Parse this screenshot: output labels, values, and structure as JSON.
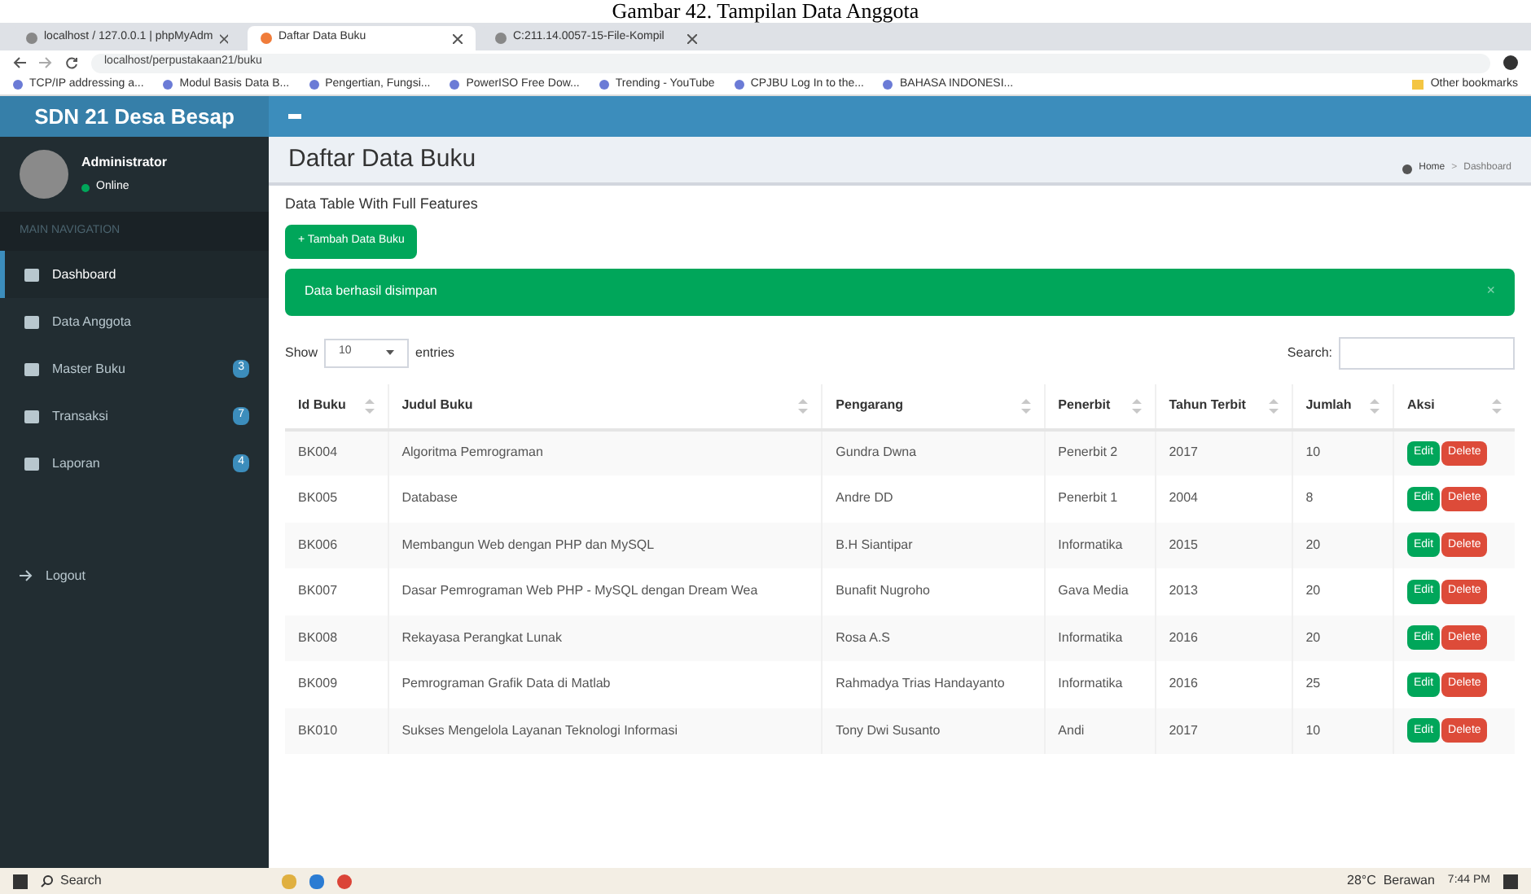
{
  "caption": "Gambar 42. Tampilan Data Anggota",
  "browser": {
    "tabs": [
      {
        "title": "localhost / 127.0.0.1 | phpMyAdm",
        "selected": false
      },
      {
        "title": "Daftar Data Buku",
        "selected": true
      },
      {
        "title": "C:211.14.0057-15-File-Kompil",
        "selected": false
      }
    ],
    "address": "localhost/perpustakaan21/buku",
    "bookmarks": [
      "TCP/IP addressing a...",
      "Modul Basis Data B...",
      "Pengertian, Fungsi...",
      "PowerISO Free Dow...",
      "Trending - YouTube",
      "CPJBU Log In to the...",
      "BAHASA INDONESI..."
    ],
    "other_bookmarks": "Other bookmarks"
  },
  "app": {
    "brand": "SDN 21 Desa Besap",
    "user": {
      "name": "Administrator",
      "status": "Online"
    },
    "nav_header": "MAIN NAVIGATION",
    "nav": [
      {
        "label": "Dashboard",
        "selected": true
      },
      {
        "label": "Data Anggota",
        "selected": false
      },
      {
        "label": "Master Buku",
        "selected": false,
        "badge": "3"
      },
      {
        "label": "Transaksi",
        "selected": false,
        "badge": "7"
      },
      {
        "label": "Laporan",
        "selected": false,
        "badge": "4"
      }
    ],
    "logout": "Logout",
    "page_title": "Daftar Data Buku",
    "breadcrumb": [
      "Home",
      "Dashboard"
    ],
    "breadcrumb_separator": ">",
    "subtitle": "Data Table With Full Features",
    "add_button": "+ Tambah Data Buku",
    "alert": {
      "text": "Data berhasil disimpan",
      "close": "×"
    },
    "show_label": "Show",
    "show_value": "10",
    "entries_label": "entries",
    "search_label": "Search:",
    "table": {
      "columns": [
        "Id Buku",
        "Judul Buku",
        "Pengarang",
        "Penerbit",
        "Tahun Terbit",
        "Jumlah",
        "Aksi"
      ],
      "rows": [
        {
          "cells": [
            "BK004",
            "Algoritma Pemrograman",
            "Gundra Dwna",
            "Penerbit 2",
            "2017",
            "10"
          ],
          "actions": [
            "Edit",
            "Delete"
          ]
        },
        {
          "cells": [
            "BK005",
            "Database",
            "Andre DD",
            "Penerbit 1",
            "2004",
            "8"
          ],
          "actions": [
            "Edit",
            "Delete"
          ]
        },
        {
          "cells": [
            "BK006",
            "Membangun Web dengan PHP dan MySQL",
            "B.H Siantipar",
            "Informatika",
            "2015",
            "20"
          ],
          "actions": [
            "Edit",
            "Delete"
          ]
        },
        {
          "cells": [
            "BK007",
            "Dasar Pemrograman Web PHP - MySQL dengan Dream Wea",
            "Bunafit Nugroho",
            "Gava Media",
            "2013",
            "20"
          ],
          "actions": [
            "Edit",
            "Delete"
          ]
        },
        {
          "cells": [
            "BK008",
            "Rekayasa Perangkat Lunak",
            "Rosa A.S",
            "Informatika",
            "2016",
            "20"
          ],
          "actions": [
            "Edit",
            "Delete"
          ]
        },
        {
          "cells": [
            "BK009",
            "Pemrograman Grafik Data di Matlab",
            "Rahmadya Trias Handayanto",
            "Informatika",
            "2016",
            "25"
          ],
          "actions": [
            "Edit",
            "Delete"
          ]
        },
        {
          "cells": [
            "BK010",
            "Sukses Mengelola Layanan Teknologi Informasi",
            "Tony Dwi Susanto",
            "Andi",
            "2017",
            "10"
          ],
          "actions": [
            "Edit",
            "Delete"
          ]
        }
      ]
    }
  },
  "taskbar": {
    "search": "Search",
    "weather": "28°C  Berawan",
    "time": "7:44 PM"
  }
}
